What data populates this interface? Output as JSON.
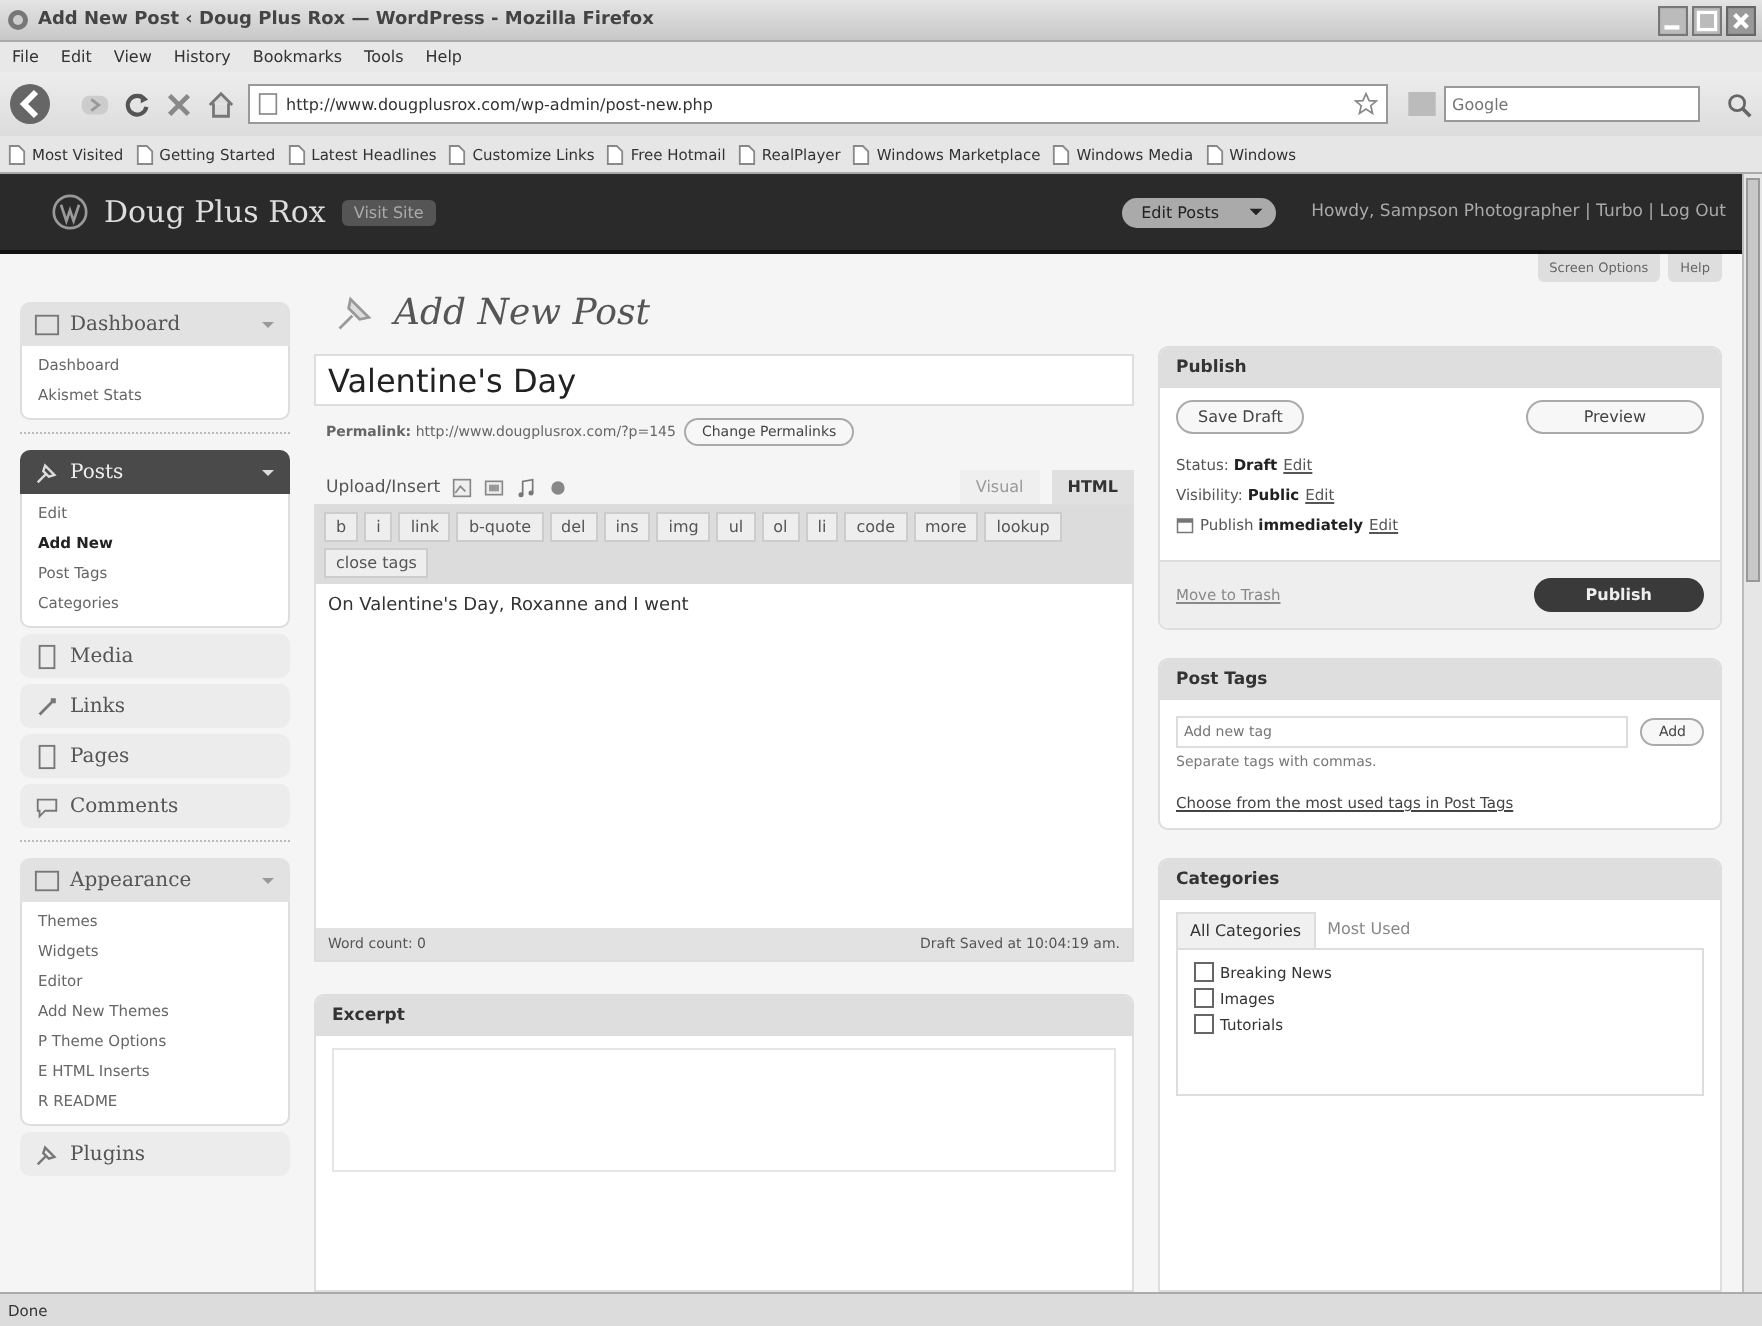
{
  "window": {
    "title": "Add New Post ‹ Doug Plus Rox — WordPress - Mozilla Firefox"
  },
  "menu_bar": [
    "File",
    "Edit",
    "View",
    "History",
    "Bookmarks",
    "Tools",
    "Help"
  ],
  "nav_bar": {
    "url": "http://www.dougplusrox.com/wp-admin/post-new.php",
    "search_placeholder": "Google"
  },
  "bookmarks": [
    "Most Visited",
    "Getting Started",
    "Latest Headlines",
    "Customize Links",
    "Free Hotmail",
    "RealPlayer",
    "Windows Marketplace",
    "Windows Media",
    "Windows"
  ],
  "site_header": {
    "site_name": "Doug Plus Rox",
    "visit_site": "Visit Site",
    "action_menu": "Edit Posts",
    "user_links": "Howdy, Sampson Photographer | Turbo | Log Out"
  },
  "screen_links": [
    "Screen Options",
    "Help"
  ],
  "sidebar": [
    {
      "kind": "menu",
      "label": "Dashboard",
      "selected": false,
      "children": [
        {
          "label": "Dashboard",
          "selected": false
        },
        {
          "label": "Akismet Stats",
          "selected": false
        }
      ]
    },
    {
      "kind": "separator"
    },
    {
      "kind": "menu",
      "label": "Posts",
      "selected": true,
      "children": [
        {
          "label": "Edit",
          "selected": false
        },
        {
          "label": "Add New",
          "selected": true
        },
        {
          "label": "Post Tags",
          "selected": false
        },
        {
          "label": "Categories",
          "selected": false
        }
      ]
    },
    {
      "kind": "menu",
      "label": "Media",
      "selected": false
    },
    {
      "kind": "menu",
      "label": "Links",
      "selected": false
    },
    {
      "kind": "menu",
      "label": "Pages",
      "selected": false
    },
    {
      "kind": "menu",
      "label": "Comments",
      "selected": false
    },
    {
      "kind": "separator"
    },
    {
      "kind": "menu",
      "label": "Appearance",
      "selected": false,
      "children": [
        {
          "label": "Themes",
          "selected": false
        },
        {
          "label": "Widgets",
          "selected": false
        },
        {
          "label": "Editor",
          "selected": false
        },
        {
          "label": "Add New Themes",
          "selected": false
        },
        {
          "label": "P Theme Options",
          "selected": false
        },
        {
          "label": "E HTML Inserts",
          "selected": false
        },
        {
          "label": "R README",
          "selected": false
        }
      ]
    },
    {
      "kind": "menu",
      "label": "Plugins",
      "selected": false
    }
  ],
  "page_title": "Add New Post",
  "post_title": "Valentine's Day",
  "permalink": {
    "label": "Permalink:",
    "url": "http://www.dougplusrox.com/?p=145",
    "button": "Change Permalinks"
  },
  "upload_label": "Upload/Insert",
  "editor_tabs": [
    {
      "label": "Visual",
      "selected": false
    },
    {
      "label": "HTML",
      "selected": true
    }
  ],
  "quicktags": [
    "b",
    "i",
    "link",
    "b-quote",
    "del",
    "ins",
    "img",
    "ul",
    "ol",
    "li",
    "code",
    "more",
    "lookup",
    "close tags"
  ],
  "content": "On Valentine's Day, Roxanne and I went",
  "word_count": "Word count: 0",
  "draft_saved": "Draft Saved at 10:04:19 am.",
  "excerpt": {
    "title": "Excerpt"
  },
  "publish": {
    "title": "Publish",
    "save_draft": "Save Draft",
    "preview": "Preview",
    "rows": [
      {
        "kind": "plain",
        "label": "Status:",
        "value": "Draft",
        "link": "Edit"
      },
      {
        "kind": "plain",
        "label": "Visibility:",
        "value": "Public",
        "link": "Edit"
      },
      {
        "kind": "calendar",
        "label": "Publish",
        "value": "immediately",
        "link": "Edit"
      }
    ],
    "trash": "Move to Trash",
    "publish_button": "Publish"
  },
  "post_tags": {
    "title": "Post Tags",
    "placeholder": "Add new tag",
    "add": "Add",
    "hint": "Separate tags with commas.",
    "link": "Choose from the most used tags in Post Tags"
  },
  "categories": {
    "title": "Categories",
    "tabs": [
      {
        "label": "All Categories",
        "selected": true
      },
      {
        "label": "Most Used",
        "selected": false
      }
    ],
    "items": [
      {
        "label": "Breaking News",
        "checked": false
      },
      {
        "label": "Images",
        "checked": false
      },
      {
        "label": "Tutorials",
        "checked": false
      }
    ]
  },
  "status_bar": "Done"
}
